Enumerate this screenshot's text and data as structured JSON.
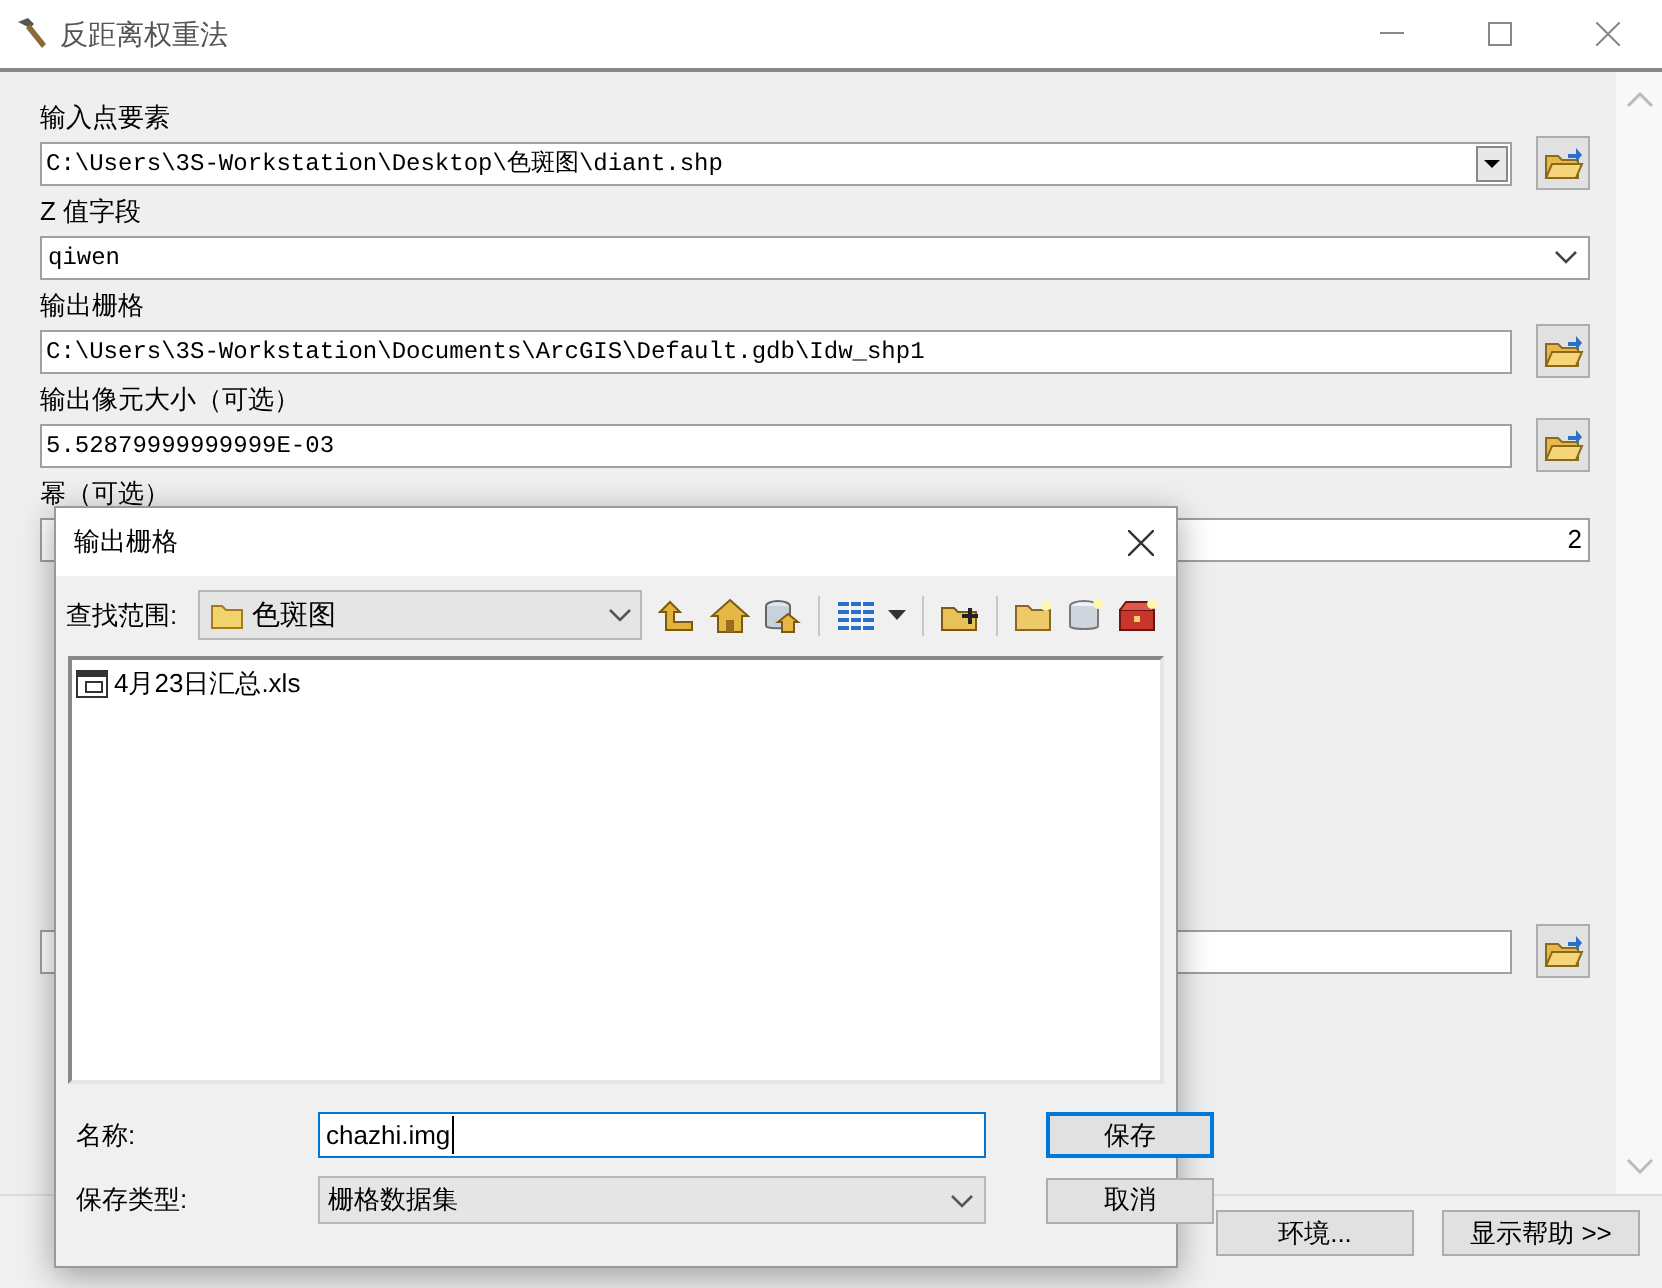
{
  "window": {
    "title": "反距离权重法"
  },
  "parameters": [
    {
      "label": "输入点要素",
      "kind": "combo",
      "value": "C:\\Users\\3S-Workstation\\Desktop\\色斑图\\diant.shp",
      "browse": true
    },
    {
      "label": "Z 值字段",
      "kind": "dropdown",
      "value": "qiwen",
      "browse": false
    },
    {
      "label": "输出栅格",
      "kind": "text",
      "value": "C:\\Users\\3S-Workstation\\Documents\\ArcGIS\\Default.gdb\\Idw_shp1",
      "browse": true
    },
    {
      "label": "输出像元大小（可选）",
      "kind": "text",
      "value": "5.52879999999999E-03",
      "browse": true
    },
    {
      "label": "幂（可选）",
      "kind": "number",
      "value": "2",
      "browse": false
    }
  ],
  "bottom_buttons": [
    "环境...",
    "显示帮助 >>"
  ],
  "dialog": {
    "title": "输出栅格",
    "look_in": {
      "label": "查找范围:",
      "value": "色斑图"
    },
    "files": [
      {
        "name": "4月23日汇总.xls",
        "selected": false
      }
    ],
    "name_field": {
      "label": "名称:",
      "value": "chazhi.img"
    },
    "type_field": {
      "label": "保存类型:",
      "value": "栅格数据集"
    },
    "buttons": [
      {
        "label": "保存",
        "default": true
      },
      {
        "label": "取消",
        "default": false
      }
    ]
  }
}
